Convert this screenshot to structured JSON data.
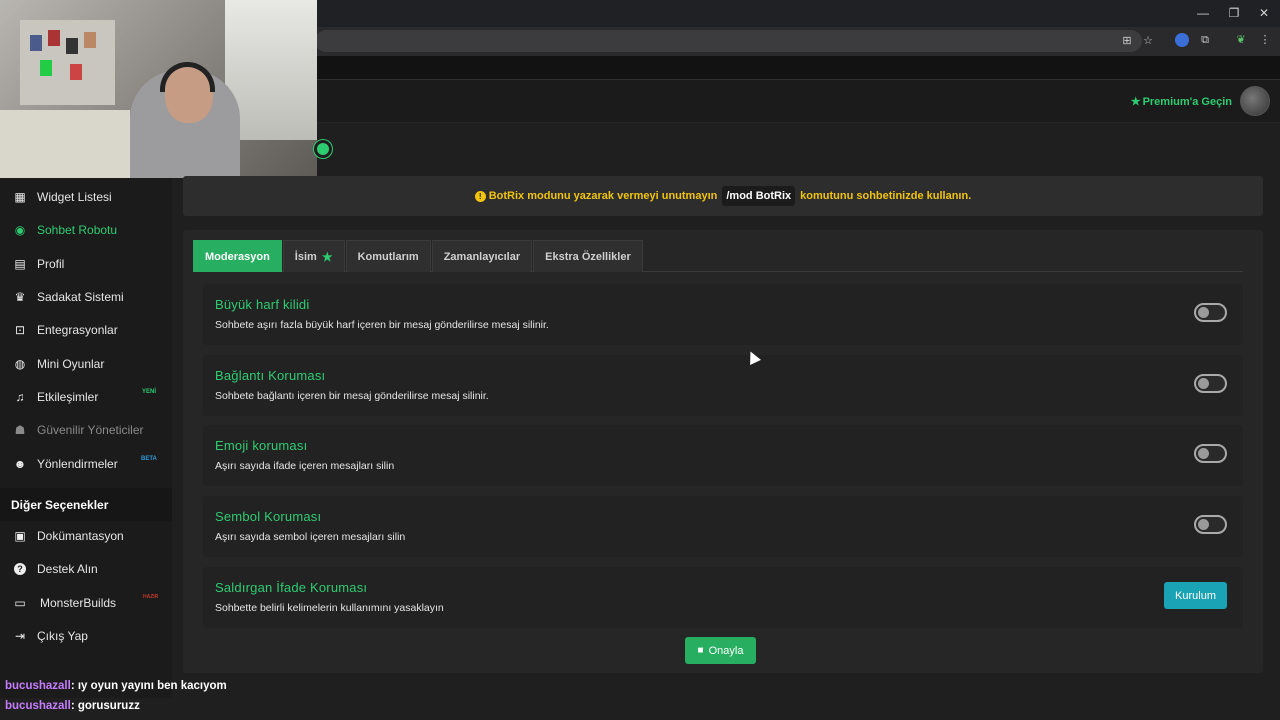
{
  "browser": {
    "window_controls": [
      "—",
      "❐",
      "✕"
    ],
    "ext_icons": [
      "translate-icon",
      "star-icon",
      "extension-icon",
      "puzzle-icon",
      "leaf-icon",
      "menu-icon"
    ]
  },
  "header": {
    "premium_label": "Premium'a Geçin"
  },
  "sidebar": {
    "items": [
      {
        "label": "Widget Listesi",
        "icon": "grid-icon",
        "glyph": "▦"
      },
      {
        "label": "Sohbet Robotu",
        "icon": "robot-icon",
        "glyph": "◉"
      },
      {
        "label": "Profil",
        "icon": "id-card-icon",
        "glyph": "▤"
      },
      {
        "label": "Sadakat Sistemi",
        "icon": "trophy-icon",
        "glyph": "♛"
      },
      {
        "label": "Entegrasyonlar",
        "icon": "plug-icon",
        "glyph": "⊡"
      },
      {
        "label": "Mini Oyunlar",
        "icon": "gamepad-icon",
        "glyph": "◍"
      },
      {
        "label": "Etkileşimler",
        "icon": "music-icon",
        "glyph": "♫",
        "tag": "YENİ"
      },
      {
        "label": "Güvenilir Yöneticiler",
        "icon": "users-icon",
        "glyph": "☗"
      },
      {
        "label": "Yönlendirmeler",
        "icon": "user-group-icon",
        "glyph": "☻",
        "tag": "BETA"
      }
    ],
    "section_title": "Diğer Seçenekler",
    "other_items": [
      {
        "label": "Dokümantasyon",
        "icon": "book-icon",
        "glyph": "▣"
      },
      {
        "label": "Destek Alın",
        "icon": "question-icon",
        "glyph": "?"
      },
      {
        "label": "MonsterBuilds",
        "icon": "laptop-icon",
        "glyph": "▭",
        "tag": "HAZIR"
      },
      {
        "label": "Çıkış Yap",
        "icon": "logout-icon",
        "glyph": "⇥"
      }
    ]
  },
  "alert": {
    "before": "BotRix modunu yazarak vermeyi unutmayın",
    "code": "/mod BotRix",
    "after": "komutunu sohbetinizde kullanın."
  },
  "tabs": [
    {
      "label": "Moderasyon",
      "active": true
    },
    {
      "label": "İsim",
      "star": true
    },
    {
      "label": "Komutlarım"
    },
    {
      "label": "Zamanlayıcılar"
    },
    {
      "label": "Ekstra Özellikler"
    }
  ],
  "options": [
    {
      "title": "Büyük harf kilidi",
      "desc": "Sohbete aşırı fazla büyük harf içeren bir mesaj gönderilirse mesaj silinir.",
      "control": "toggle",
      "enabled": false
    },
    {
      "title": "Bağlantı Koruması",
      "desc": "Sohbete bağlantı içeren bir mesaj gönderilirse mesaj silinir.",
      "control": "toggle",
      "enabled": false
    },
    {
      "title": "Emoji koruması",
      "desc": "Aşırı sayıda ifade içeren mesajları silin",
      "control": "toggle",
      "enabled": false
    },
    {
      "title": "Sembol Koruması",
      "desc": "Aşırı sayıda sembol içeren mesajları silin",
      "control": "toggle",
      "enabled": false
    },
    {
      "title": "Saldırgan İfade Koruması",
      "desc": "Sohbette belirli kelimelerin kullanımını yasaklayın",
      "control": "button",
      "button_label": "Kurulum"
    }
  ],
  "save_label": "Onayla",
  "chat_overlay": [
    {
      "user": "bucushazall",
      "text": ": ıy oyun yayını ben kacıyom"
    },
    {
      "user": "bucushazall",
      "text": ": gorusuruzz"
    }
  ],
  "colors": {
    "accent": "#2ecc71",
    "alert_text": "#f1c40f",
    "setup_button": "#1aa3b5"
  }
}
